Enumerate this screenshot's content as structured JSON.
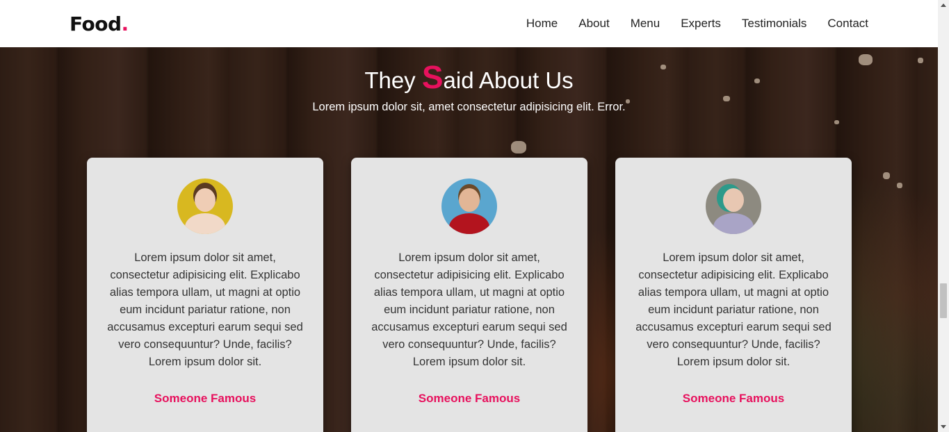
{
  "navbar": {
    "logo_text": "Food",
    "logo_dot": ".",
    "links": [
      "Home",
      "About",
      "Menu",
      "Experts",
      "Testimonials",
      "Contact"
    ]
  },
  "testimonials": {
    "title_before": "They ",
    "title_highlight": "S",
    "title_after": "aid About Us",
    "subtitle": "Lorem ipsum dolor sit, amet consectetur adipisicing elit. Error.",
    "cards": [
      {
        "text": "Lorem ipsum dolor sit amet, consectetur adipisicing elit. Explicabo alias tempora ullam, ut magni at optio eum incidunt pariatur ratione, non accusamus excepturi earum sequi sed vero consequuntur? Unde, facilis?Lorem ipsum dolor sit.",
        "name": "Someone Famous"
      },
      {
        "text": "Lorem ipsum dolor sit amet, consectetur adipisicing elit. Explicabo alias tempora ullam, ut magni at optio eum incidunt pariatur ratione, non accusamus excepturi earum sequi sed vero consequuntur? Unde, facilis?Lorem ipsum dolor sit.",
        "name": "Someone Famous"
      },
      {
        "text": "Lorem ipsum dolor sit amet, consectetur adipisicing elit. Explicabo alias tempora ullam, ut magni at optio eum incidunt pariatur ratione, non accusamus excepturi earum sequi sed vero consequuntur? Unde, facilis?Lorem ipsum dolor sit.",
        "name": "Someone Famous"
      }
    ]
  },
  "colors": {
    "accent": "#e7115d",
    "card_bg": "#e4e4e4",
    "navbar_bg": "#ffffff"
  }
}
